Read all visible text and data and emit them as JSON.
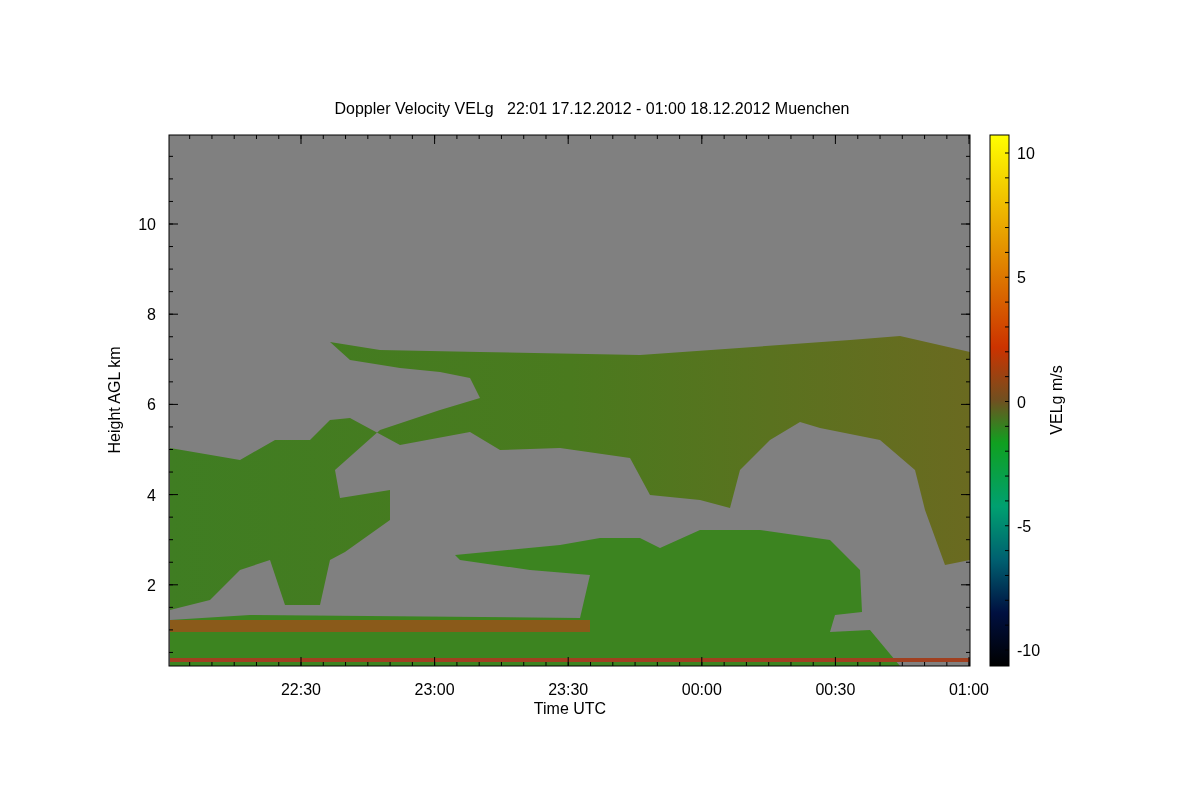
{
  "title": "Doppler Velocity VELg   22:01 17.12.2012 - 01:00 18.12.2012 Muenchen",
  "y_axis": {
    "label": "Height AGL km",
    "ticks": [
      "10",
      "8",
      "6",
      "4",
      "2"
    ]
  },
  "x_axis": {
    "label": "Time UTC",
    "ticks": [
      "22:30",
      "23:00",
      "23:30",
      "00:00",
      "00:30",
      "01:00"
    ]
  },
  "colorbar": {
    "label": "VELg m/s",
    "ticks": [
      "10",
      "5",
      "0",
      "-5",
      "-10"
    ]
  }
}
